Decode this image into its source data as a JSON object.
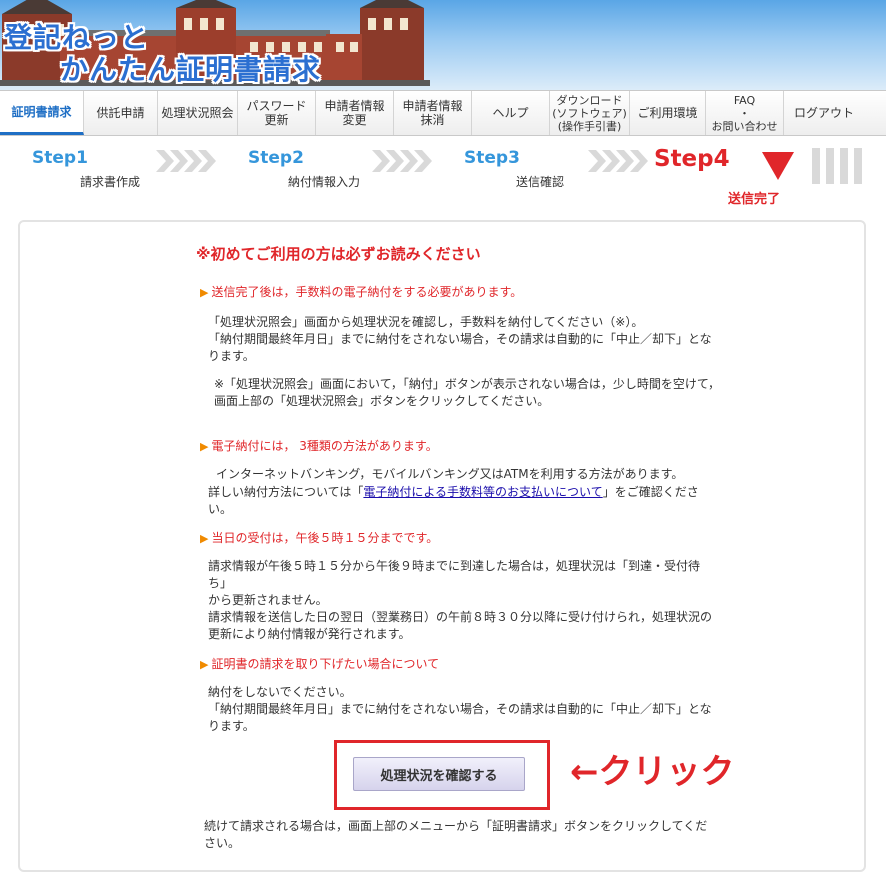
{
  "header": {
    "logo_line1": "登記ねっと",
    "logo_line2": "かんたん証明書請求"
  },
  "menu": {
    "items": [
      {
        "label": "証明書請求"
      },
      {
        "label": "供託申請"
      },
      {
        "label": "処理状況照会"
      },
      {
        "label": "パスワード\n更新"
      },
      {
        "label": "申請者情報\n変更"
      },
      {
        "label": "申請者情報\n抹消"
      },
      {
        "label": "ヘルプ"
      },
      {
        "label": "ダウンロード\n(ソフトウェア)\n(操作手引書)"
      },
      {
        "label": "ご利用環境"
      },
      {
        "label": "FAQ\n・\nお問い合わせ"
      },
      {
        "label": "ログアウト"
      }
    ],
    "active_index": 0
  },
  "steps": [
    {
      "num": "Step1",
      "caption": "請求書作成"
    },
    {
      "num": "Step2",
      "caption": "納付情報入力"
    },
    {
      "num": "Step3",
      "caption": "送信確認"
    },
    {
      "num": "Step4",
      "caption": "送信完了"
    }
  ],
  "content": {
    "notice": "※初めてご利用の方は必ずお読みください",
    "sections": [
      {
        "heading": "送信完了後は，手数料の電子納付をする必要があります。",
        "paragraphs": [
          "「処理状況照会」画面から処理状況を確認し，手数料を納付してください（※）。\n「納付期間最終年月日」までに納付をされない場合，その請求は自動的に「中止／却下」となります。",
          "※「処理状況照会」画面において，「納付」ボタンが表示されない場合は，少し時間を空けて，\n画面上部の「処理状況照会」ボタンをクリックしてください。"
        ]
      },
      {
        "heading": "電子納付には， 3種類の方法があります。",
        "paragraphs": [
          "インターネットバンキング，モバイルバンキング又はATMを利用する方法があります。"
        ],
        "link_para": {
          "before": "詳しい納付方法については「",
          "link": "電子納付による手数料等のお支払いについて",
          "after": "」をご確認ください。"
        }
      },
      {
        "heading": "当日の受付は，午後５時１５分までです。",
        "paragraphs": [
          "請求情報が午後５時１５分から午後９時までに到達した場合は，処理状況は「到達・受付待ち」\nから更新されません。\n請求情報を送信した日の翌日（翌業務日）の午前８時３０分以降に受け付けられ，処理状況の更新により納付情報が発行されます。"
        ]
      },
      {
        "heading": "証明書の請求を取り下げたい場合について",
        "paragraphs": [
          "納付をしないでください。\n「納付期間最終年月日」までに納付をされない場合，その請求は自動的に「中止／却下」となります。"
        ]
      }
    ],
    "button_label": "処理状況を確認する",
    "click_note": "←クリック",
    "footer_text": "続けて請求される場合は，画面上部のメニューから「証明書請求」ボタンをクリックしてください。"
  },
  "colors": {
    "accent_blue": "#1f6fc5",
    "step_blue": "#3596db",
    "alert_red": "#e0262a",
    "arrow_orange": "#f08a00"
  }
}
